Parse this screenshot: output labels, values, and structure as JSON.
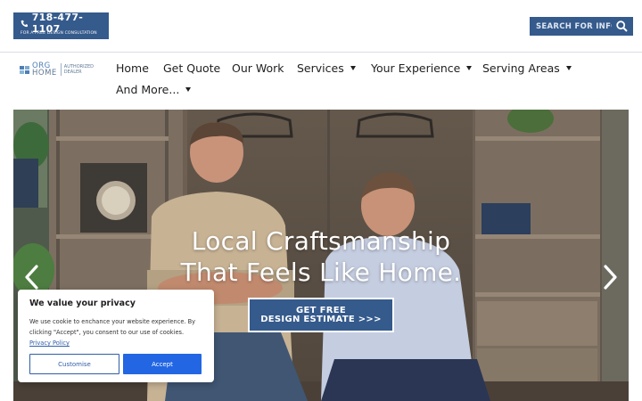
{
  "topbar": {
    "phone": "718-477-1107",
    "phone_sub": "FOR A FREE DESIGN CONSULTATION",
    "search_placeholder": "SEARCH FOR INFO"
  },
  "logo": {
    "line1": "ORG",
    "line2": "HOME",
    "auth1": "AUTHORIZED",
    "auth2": "DEALER"
  },
  "nav": {
    "items": [
      {
        "label": "Home",
        "dropdown": false
      },
      {
        "label": "Get Quote",
        "dropdown": false
      },
      {
        "label": "Our Work",
        "dropdown": false
      },
      {
        "label": "Services",
        "dropdown": true
      },
      {
        "label": "Your Experience",
        "dropdown": true
      },
      {
        "label": "Serving Areas",
        "dropdown": true
      },
      {
        "label": "And More...",
        "dropdown": true
      }
    ]
  },
  "hero": {
    "title_line1": "Local Craftsmanship",
    "title_line2": "That Feels Like Home.",
    "cta_line1": "GET FREE",
    "cta_line2": "DESIGN ESTIMATE >>>"
  },
  "cookie": {
    "title": "We value your privacy",
    "text": "We use cookie to enchance your website experience. By clicking \"Accept\", you consent to our use of cookies.",
    "policy_link": "Privacy Policy",
    "customise": "Customise",
    "accept": "Accept"
  },
  "colors": {
    "brand": "#355a8c",
    "accept": "#2266e3",
    "link": "#2f5ea8"
  }
}
